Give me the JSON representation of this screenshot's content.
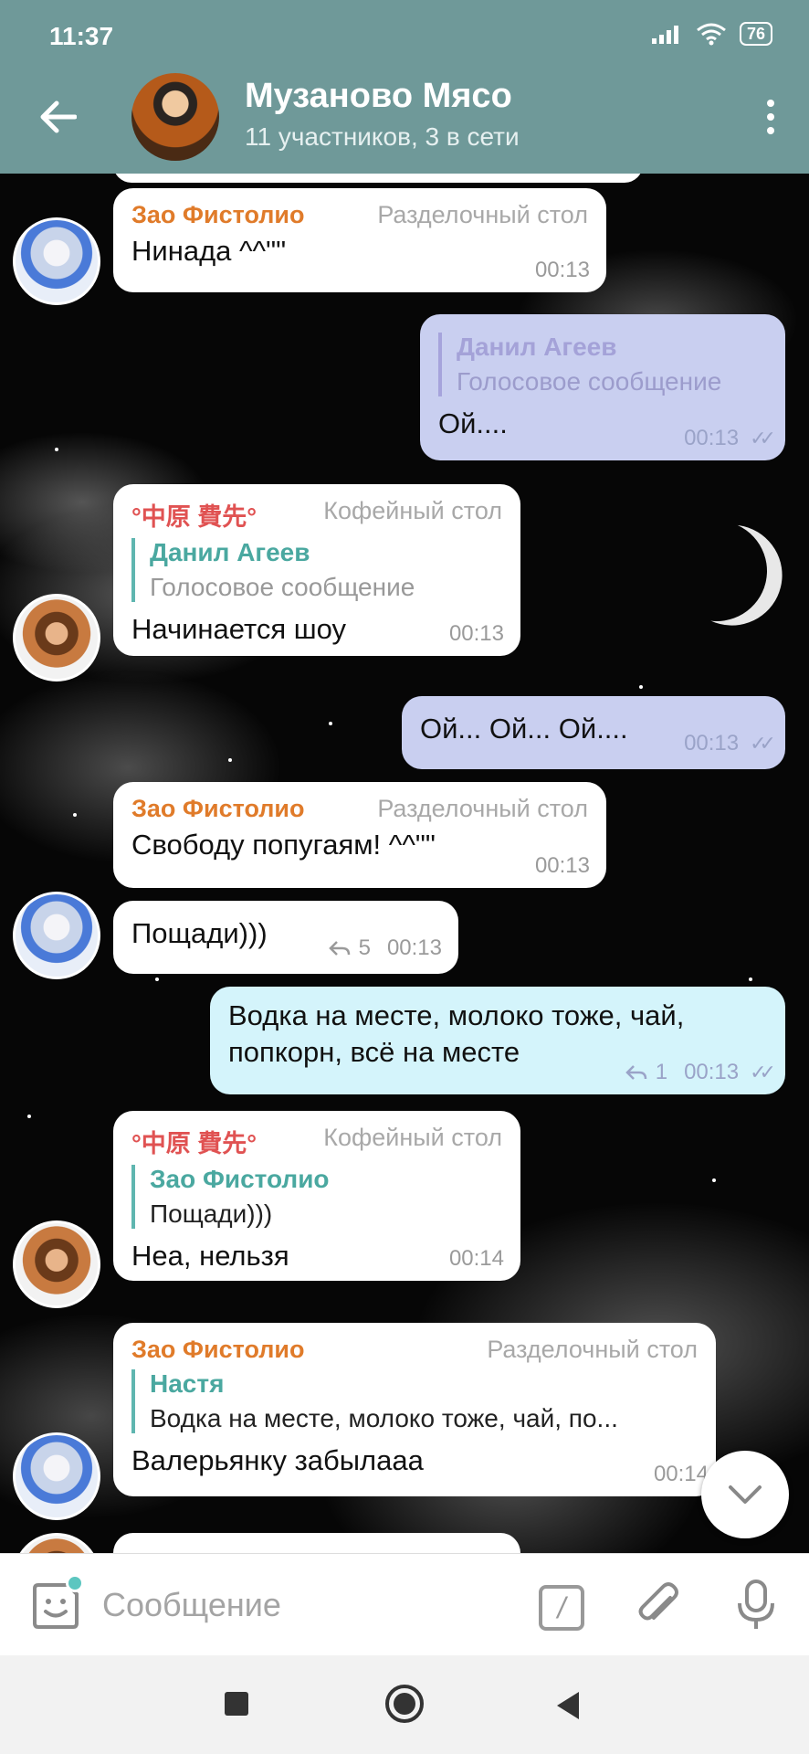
{
  "status_bar": {
    "time": "11:37",
    "battery": "76"
  },
  "header": {
    "title": "Музаново Мясо",
    "subtitle": "11 участников, 3 в сети"
  },
  "messages": [
    {
      "author": "Зао Фистолио",
      "role": "Разделочный стол",
      "text": "Нинада ^^\"\"",
      "time": "00:13"
    },
    {
      "outgoing": true,
      "reply_name": "Данил Агеев",
      "reply_text": "Голосовое сообщение",
      "text": "Ой....",
      "time": "00:13"
    },
    {
      "author": "°中原 費先°",
      "role": "Кофейный стол",
      "reply_name": "Данил Агеев",
      "reply_text": "Голосовое сообщение",
      "text": "Начинается шоу",
      "time": "00:13"
    },
    {
      "outgoing": true,
      "text": "Ой... Ой... Ой....",
      "time": "00:13"
    },
    {
      "author": "Зао Фистолио",
      "role": "Разделочный стол",
      "text": "Свободу попугаям! ^^\"\"",
      "time": "00:13"
    },
    {
      "text": "Пощади)))",
      "replies": "5",
      "time": "00:13"
    },
    {
      "outgoing": true,
      "line1": "Водка на месте, молоко тоже, чай,",
      "line2": "попкорн, всё на месте",
      "replies": "1",
      "time": "00:13"
    },
    {
      "author": "°中原 費先°",
      "role": "Кофейный стол",
      "reply_name": "Зао Фистолио",
      "reply_text": "Пощади)))",
      "text": "Неа, нельзя",
      "time": "00:14"
    },
    {
      "author": "Зао Фистолио",
      "role": "Разделочный стол",
      "reply_name": "Настя",
      "reply_text": "Водка на месте, молоко тоже, чай, по...",
      "text": "Валерьянку забылааа",
      "time": "00:14"
    }
  ],
  "input": {
    "placeholder": "Сообщение",
    "command_symbol": "/"
  },
  "icons": {
    "back": "arrow-left-icon",
    "menu": "more-vertical-icon",
    "sticker": "sticker-icon",
    "attach": "paperclip-icon",
    "mic": "microphone-icon",
    "scroll": "chevron-down-icon",
    "read": "double-check-icon",
    "reply_count": "reply-arrow-icon"
  },
  "colors": {
    "header": "#6f9999",
    "outgoing_bubble": "#c9cff0",
    "outgoing_bubble_highlight": "#d4f4fb",
    "name_orange": "#e07b2a",
    "name_red": "#e05252",
    "reply_accent": "#5fb6b0"
  }
}
